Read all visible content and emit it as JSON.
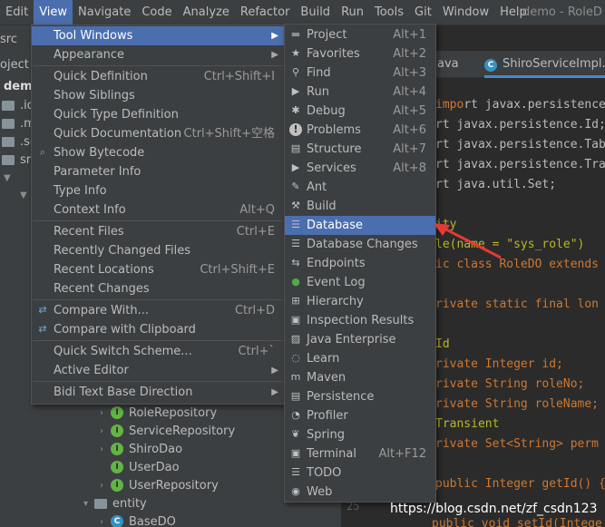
{
  "menubar": {
    "items": [
      "Edit",
      "View",
      "Navigate",
      "Code",
      "Analyze",
      "Refactor",
      "Build",
      "Run",
      "Tools",
      "Git",
      "Window",
      "Help"
    ],
    "title": "demo - RoleD"
  },
  "project": {
    "src_tab": "src",
    "project_label": "oject",
    "root": "demo",
    "small_rows": [
      ".id",
      ".m",
      ".se",
      "src"
    ],
    "tree": [
      {
        "label": "RoleRepository",
        "kind": "i"
      },
      {
        "label": "ServiceRepository",
        "kind": "i"
      },
      {
        "label": "ShiroDao",
        "kind": "i"
      },
      {
        "label": "UserDao",
        "kind": "i"
      },
      {
        "label": "UserRepository",
        "kind": "i"
      },
      {
        "label": "entity",
        "kind": "folder"
      },
      {
        "label": "BaseDO",
        "kind": "c"
      }
    ]
  },
  "editor": {
    "tabs": [
      "ava",
      "ShiroServiceImpl.java"
    ],
    "lines": [
      "rt javax.persistence.Ent",
      "rt javax.persistence.Id;",
      "rt javax.persistence.Tab",
      "rt javax.persistence.Tra",
      "rt java.util.Set;",
      "ity",
      "le(name = \"sys_role\")",
      "ic class RoleDO extends ",
      "rivate static final lon",
      "Id",
      "rivate Integer id;",
      "rivate String roleNo;",
      "rivate String roleName;",
      "Transient",
      "rivate Set<String> perm",
      "public Integer getId() {",
      "public void setId(Intege"
    ],
    "gutter_25": "25"
  },
  "view_menu": {
    "items": [
      {
        "label": "Tool Windows",
        "shortcut": "",
        "submenu": true,
        "selected": true
      },
      {
        "label": "Appearance",
        "shortcut": "",
        "submenu": true
      },
      {
        "label": "Quick Definition",
        "shortcut": "Ctrl+Shift+I"
      },
      {
        "label": "Show Siblings",
        "shortcut": ""
      },
      {
        "label": "Quick Type Definition",
        "shortcut": ""
      },
      {
        "label": "Quick Documentation",
        "shortcut": "Ctrl+Shift+空格"
      },
      {
        "label": "Show Bytecode",
        "shortcut": ""
      },
      {
        "label": "Parameter Info",
        "shortcut": ""
      },
      {
        "label": "Type Info",
        "shortcut": ""
      },
      {
        "label": "Context Info",
        "shortcut": "Alt+Q"
      },
      {
        "label": "Recent Files",
        "shortcut": "Ctrl+E"
      },
      {
        "label": "Recently Changed Files",
        "shortcut": ""
      },
      {
        "label": "Recent Locations",
        "shortcut": "Ctrl+Shift+E"
      },
      {
        "label": "Recent Changes",
        "shortcut": ""
      },
      {
        "label": "Compare With...",
        "shortcut": "Ctrl+D"
      },
      {
        "label": "Compare with Clipboard",
        "shortcut": ""
      },
      {
        "label": "Quick Switch Scheme...",
        "shortcut": "Ctrl+`"
      },
      {
        "label": "Active Editor",
        "shortcut": "",
        "submenu": true
      },
      {
        "label": "Bidi Text Base Direction",
        "shortcut": "",
        "submenu": true
      }
    ]
  },
  "tool_windows_menu": {
    "items": [
      {
        "label": "Project",
        "shortcut": "Alt+1",
        "icon": "folder-icon"
      },
      {
        "label": "Favorites",
        "shortcut": "Alt+2",
        "icon": "star-icon"
      },
      {
        "label": "Find",
        "shortcut": "Alt+3",
        "icon": "search-icon"
      },
      {
        "label": "Run",
        "shortcut": "Alt+4",
        "icon": "play-icon"
      },
      {
        "label": "Debug",
        "shortcut": "Alt+5",
        "icon": "bug-icon"
      },
      {
        "label": "Problems",
        "shortcut": "Alt+6",
        "icon": "warning-icon"
      },
      {
        "label": "Structure",
        "shortcut": "Alt+7",
        "icon": "structure-icon"
      },
      {
        "label": "Services",
        "shortcut": "Alt+8",
        "icon": "services-icon"
      },
      {
        "label": "Ant",
        "shortcut": "",
        "icon": "ant-icon"
      },
      {
        "label": "Build",
        "shortcut": "",
        "icon": "hammer-icon"
      },
      {
        "label": "Database",
        "shortcut": "",
        "icon": "database-icon",
        "selected": true
      },
      {
        "label": "Database Changes",
        "shortcut": "",
        "icon": "database-changes-icon"
      },
      {
        "label": "Endpoints",
        "shortcut": "",
        "icon": "endpoints-icon"
      },
      {
        "label": "Event Log",
        "shortcut": "",
        "icon": "event-log-icon"
      },
      {
        "label": "Hierarchy",
        "shortcut": "",
        "icon": "hierarchy-icon"
      },
      {
        "label": "Inspection Results",
        "shortcut": "",
        "icon": "inspection-icon"
      },
      {
        "label": "Java Enterprise",
        "shortcut": "",
        "icon": "java-enterprise-icon"
      },
      {
        "label": "Learn",
        "shortcut": "",
        "icon": "learn-icon"
      },
      {
        "label": "Maven",
        "shortcut": "",
        "icon": "maven-icon"
      },
      {
        "label": "Persistence",
        "shortcut": "",
        "icon": "persistence-icon"
      },
      {
        "label": "Profiler",
        "shortcut": "",
        "icon": "profiler-icon"
      },
      {
        "label": "Spring",
        "shortcut": "",
        "icon": "spring-icon"
      },
      {
        "label": "Terminal",
        "shortcut": "Alt+F12",
        "icon": "terminal-icon"
      },
      {
        "label": "TODO",
        "shortcut": "",
        "icon": "todo-icon"
      },
      {
        "label": "Web",
        "shortcut": "",
        "icon": "web-icon"
      }
    ]
  },
  "watermark": "https://blog.csdn.net/zf_csdn123",
  "colors": {
    "selection": "#4b6eaf",
    "menu_bg": "#3c3f41",
    "arrow": "#e53935"
  }
}
